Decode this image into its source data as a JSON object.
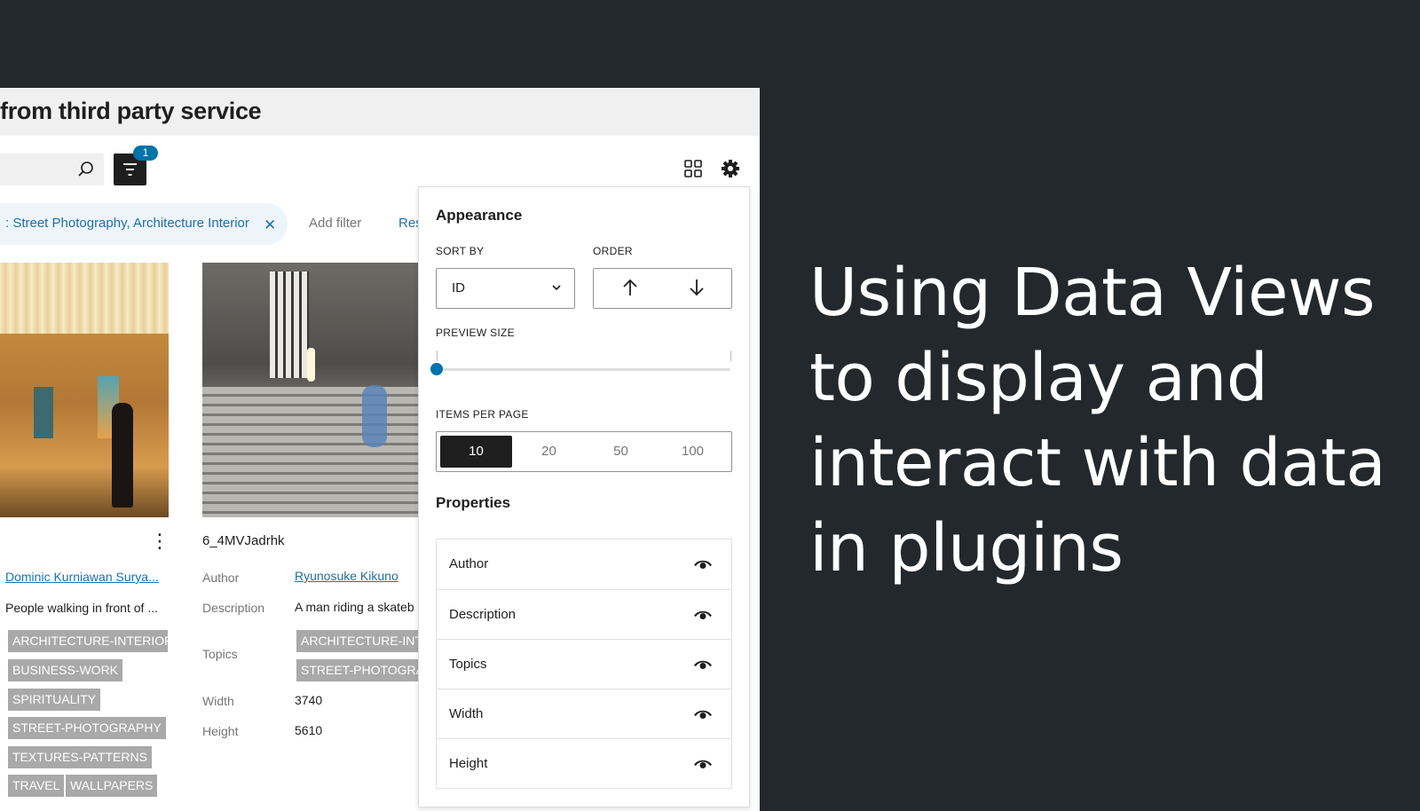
{
  "app": {
    "title": "from third party service",
    "filter_badge": "1",
    "active_filter": ": Street Photography, Architecture Interior",
    "add_filter": "Add filter",
    "reset": "Reset"
  },
  "cards": [
    {
      "author": "Dominic Kurniawan Surya...",
      "description": "People walking in front of ...",
      "tags": [
        "ARCHITECTURE-INTERIOR",
        "BUSINESS-WORK",
        "SPIRITUALITY",
        "STREET-PHOTOGRAPHY",
        "TEXTURES-PATTERNS",
        "TRAVEL",
        "WALLPAPERS"
      ]
    },
    {
      "title": "6_4MVJadrhk",
      "author_label": "Author",
      "author": "Ryunosuke Kikuno",
      "description_label": "Description",
      "description": "A man riding a skateb",
      "topics_label": "Topics",
      "tags": [
        "ARCHITECTURE-INT",
        "STREET-PHOTOGRA"
      ],
      "width_label": "Width",
      "width": "3740",
      "height_label": "Height",
      "height": "5610"
    }
  ],
  "panel": {
    "appearance": "Appearance",
    "sort_by_label": "SORT BY",
    "sort_by_value": "ID",
    "order_label": "ORDER",
    "preview_size_label": "PREVIEW SIZE",
    "preview_size_level": 0,
    "items_per_page_label": "ITEMS PER PAGE",
    "items_per_page_options": [
      "10",
      "20",
      "50",
      "100"
    ],
    "items_per_page_selected": "10",
    "properties_label": "Properties",
    "properties": [
      "Author",
      "Description",
      "Topics",
      "Width",
      "Height"
    ]
  },
  "headline": {
    "lines": [
      "Using Data Views",
      "to display and",
      "interact with data",
      "in plugins"
    ]
  },
  "colors": {
    "background": "#23282d",
    "accent": "#0073aa",
    "link": "#1f6fa6"
  }
}
